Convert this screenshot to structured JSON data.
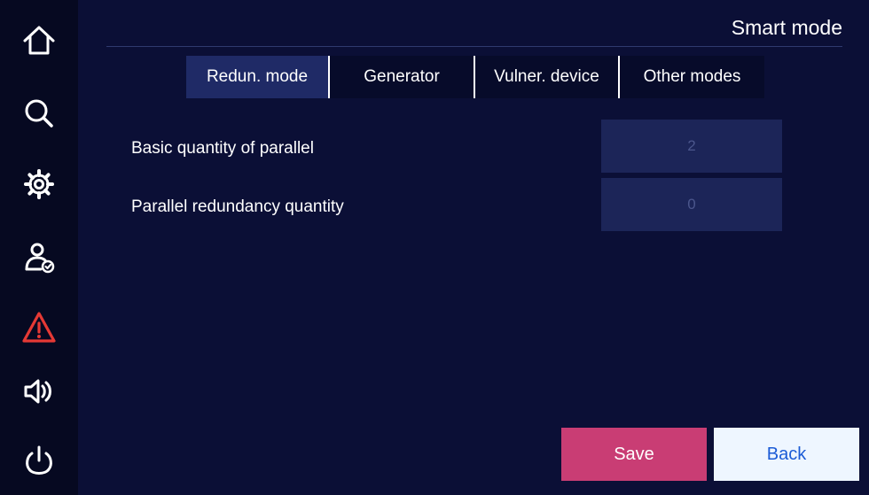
{
  "header": {
    "title": "Smart mode"
  },
  "sidebar": {
    "items": [
      {
        "icon": "home-icon"
      },
      {
        "icon": "search-icon"
      },
      {
        "icon": "gear-icon"
      },
      {
        "icon": "user-check-icon"
      },
      {
        "icon": "warning-icon",
        "color": "#e53935"
      },
      {
        "icon": "speaker-icon"
      },
      {
        "icon": "power-icon"
      }
    ]
  },
  "tabs": [
    {
      "label": "Redun. mode",
      "active": true
    },
    {
      "label": "Generator",
      "active": false
    },
    {
      "label": "Vulner. device",
      "active": false
    },
    {
      "label": "Other modes",
      "active": false
    }
  ],
  "form": {
    "rows": [
      {
        "label": "Basic quantity of parallel",
        "value": "2"
      },
      {
        "label": "Parallel redundancy quantity",
        "value": "0"
      }
    ]
  },
  "actions": {
    "save_label": "Save",
    "back_label": "Back"
  },
  "colors": {
    "background": "#0b0f36",
    "sidebar": "#060921",
    "active_tab": "#1f2a66",
    "input": "#1c2558",
    "save": "#c93d74",
    "back": "#eef6ff",
    "warning": "#e53935"
  }
}
